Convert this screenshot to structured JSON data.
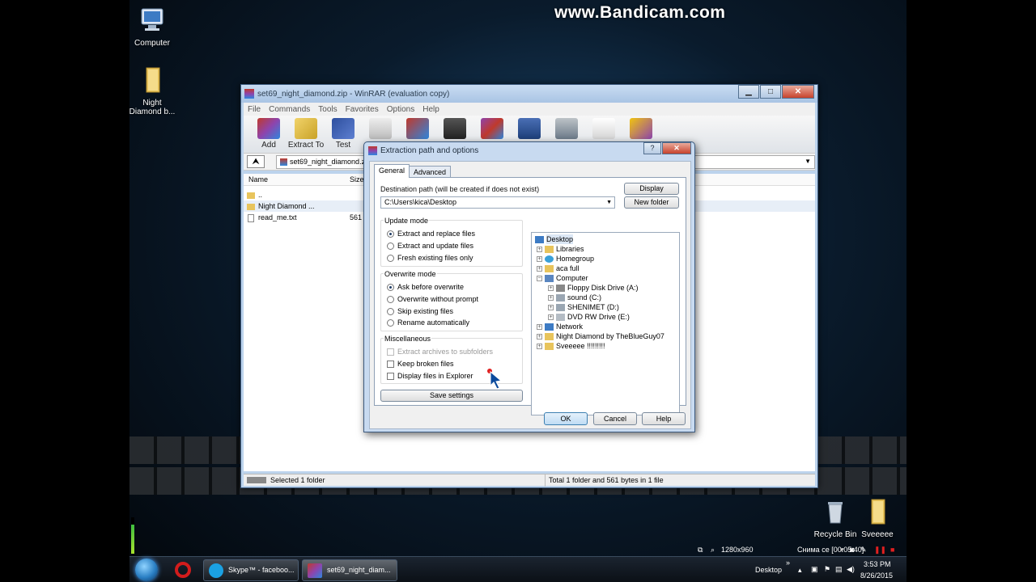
{
  "watermark": "www.Bandicam.com",
  "desktop_icons": {
    "computer": "Computer",
    "night_diamond": "Night\nDiamond b...",
    "recycle_bin": "Recycle Bin",
    "sveeeee": "Sveeeee"
  },
  "winrar": {
    "title": "set69_night_diamond.zip - WinRAR (evaluation copy)",
    "controls": {
      "minimize": "▁",
      "maximize": "□",
      "close": "✕"
    },
    "menu": [
      "File",
      "Commands",
      "Tools",
      "Favorites",
      "Options",
      "Help"
    ],
    "toolbar": [
      "Add",
      "Extract To",
      "Test",
      "View",
      "Delete",
      "Find",
      "Wizard",
      "Info",
      "VirusScan",
      "Comment",
      "SFX"
    ],
    "address": "set69_night_diamond.zip",
    "columns": {
      "name": "Name",
      "size": "Size"
    },
    "files": [
      {
        "name": "..",
        "size": "",
        "type": "folder"
      },
      {
        "name": "Night Diamond ...",
        "size": "",
        "type": "folder"
      },
      {
        "name": "read_me.txt",
        "size": "561",
        "type": "file"
      }
    ],
    "status_left": "Selected 1 folder",
    "status_right": "Total 1 folder and 561 bytes in 1 file"
  },
  "dialog": {
    "title": "Extraction path and options",
    "help_btn": "?",
    "close_btn": "✕",
    "tabs": [
      "General",
      "Advanced"
    ],
    "dest_label": "Destination path (will be created if does not exist)",
    "dest_value": "C:\\Users\\kica\\Desktop",
    "display_btn": "Display",
    "new_folder_btn": "New folder",
    "update_mode": {
      "title": "Update mode",
      "options": [
        "Extract and replace files",
        "Extract and update files",
        "Fresh existing files only"
      ],
      "selected": 0
    },
    "overwrite_mode": {
      "title": "Overwrite mode",
      "options": [
        "Ask before overwrite",
        "Overwrite without prompt",
        "Skip existing files",
        "Rename automatically"
      ],
      "selected": 0
    },
    "misc": {
      "title": "Miscellaneous",
      "options": [
        "Extract archives to subfolders",
        "Keep broken files",
        "Display files in Explorer"
      ]
    },
    "save_settings": "Save settings",
    "tree": [
      "Desktop",
      "Libraries",
      "Homegroup",
      "aca full",
      "Computer",
      "Floppy Disk Drive (A:)",
      "sound (C:)",
      "SHENIMET (D:)",
      "DVD RW Drive (E:)",
      "Network",
      "Night Diamond by TheBlueGuy07",
      "Sveeeee !!!!!!!!!"
    ],
    "ok": "OK",
    "cancel": "Cancel",
    "help": "Help"
  },
  "taskbar": {
    "skype": "Skype™ - faceboo...",
    "winrar": "set69_night_diam...",
    "desktop": "Desktop",
    "chevron": "»",
    "time": "3:53 PM",
    "date": "8/26/2015"
  },
  "recorder": {
    "resolution": "1280x960",
    "status": "Снима се [00:05:40]"
  },
  "colors": {
    "dialog_frame": "#c8daf0",
    "ok_button": "#bfdcf4",
    "close_button": "#c7432d"
  }
}
